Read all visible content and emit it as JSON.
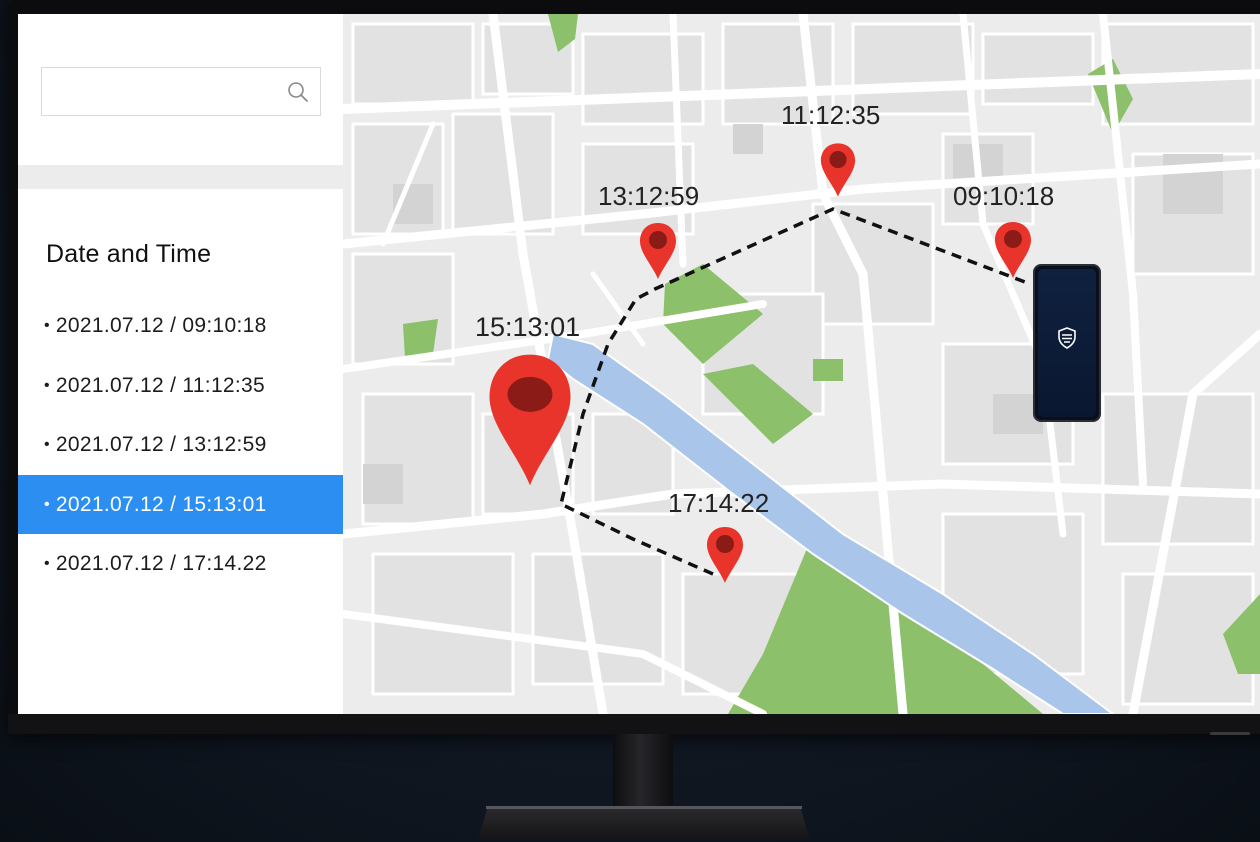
{
  "search": {
    "placeholder": ""
  },
  "sidebar": {
    "heading": "Date and Time",
    "items": [
      {
        "label": "2021.07.12 / 09:10:18",
        "selected": false
      },
      {
        "label": "2021.07.12 / 11:12:35",
        "selected": false
      },
      {
        "label": "2021.07.12 / 13:12:59",
        "selected": false
      },
      {
        "label": "2021.07.12 / 15:13:01",
        "selected": true
      },
      {
        "label": "2021.07.12 / 17:14.22",
        "selected": false
      }
    ]
  },
  "map": {
    "markers": [
      {
        "time": "11:12:35"
      },
      {
        "time": "13:12:59"
      },
      {
        "time": "09:10:18"
      },
      {
        "time": "15:13:01"
      },
      {
        "time": "17:14:22"
      }
    ]
  },
  "colors": {
    "selected": "#2b8ef0",
    "marker": "#e8342a",
    "marker_center": "#8a1b17",
    "river": "#a9c6ea",
    "park": "#8cc06b",
    "road": "#ffffff",
    "block": "#e7e7e7",
    "route": "#111111"
  },
  "icons": {
    "search": "search-icon",
    "phone": "shield-icon"
  }
}
